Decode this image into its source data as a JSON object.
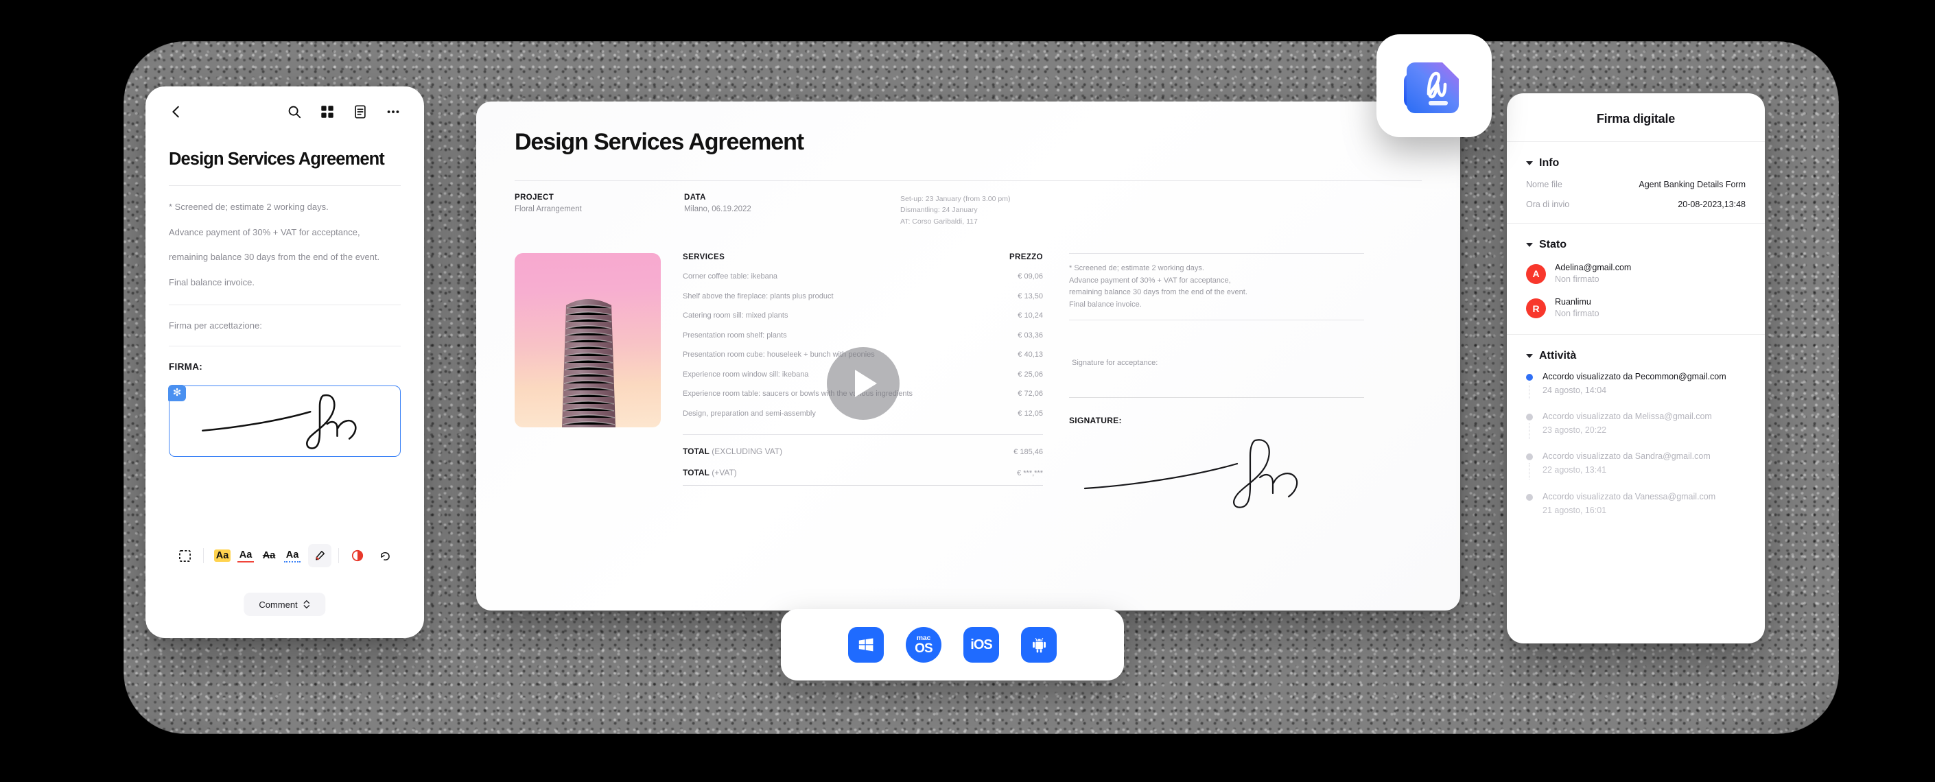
{
  "mobile_panel": {
    "back_icon": "chevron-left-icon",
    "tools": [
      "search-icon",
      "grid-icon",
      "document-icon",
      "more-icon"
    ],
    "title": "Design Services Agreement",
    "body_lines": [
      "* Screened de; estimate 2 working days.",
      "Advance payment of 30% + VAT for acceptance,",
      "remaining balance 30 days from the end of the event.",
      "Final balance invoice."
    ],
    "acceptance_label": "Firma per accettazione:",
    "signature_label": "FIRMA:",
    "signature_badge": "✻",
    "annotation_tools": [
      {
        "name": "select-area-tool",
        "label": ""
      },
      {
        "name": "highlight-tool",
        "label": "Aa"
      },
      {
        "name": "underline-tool",
        "label": "Aa"
      },
      {
        "name": "strikethrough-tool",
        "label": "Aa"
      },
      {
        "name": "squiggly-tool",
        "label": "Aa"
      },
      {
        "name": "marker-tool",
        "label": ""
      },
      {
        "name": "color-tool",
        "label": ""
      },
      {
        "name": "undo-tool",
        "label": "↺"
      }
    ],
    "comment_button": "Comment"
  },
  "document": {
    "title": "Design Services Agreement",
    "meta": [
      {
        "label": "PROJECT",
        "value": "Floral Arrangement"
      },
      {
        "label": "DATA",
        "value": "Milano, 06.19.2022"
      }
    ],
    "logistics": [
      "Set-up: 23 January (from 3.00 pm)",
      "Dismantling: 24 January",
      "AT: Corso Garibaldi, 117"
    ],
    "services_header": {
      "name": "SERVICES",
      "price": "PREZZO"
    },
    "services": [
      {
        "name": "Corner coffee table: ikebana",
        "price": "€ 09,06"
      },
      {
        "name": "Shelf above the fireplace: plants plus product",
        "price": "€ 13,50"
      },
      {
        "name": "Catering room sill: mixed plants",
        "price": "€ 10,24"
      },
      {
        "name": "Presentation room shelf: plants",
        "price": "€ 03,36"
      },
      {
        "name": "Presentation room cube: houseleek + bunch with peonies",
        "price": "€ 40,13"
      },
      {
        "name": "Experience room window sill: ikebana",
        "price": "€ 25,06"
      },
      {
        "name": "Experience room table: saucers or bowls with the various ingredients",
        "price": "€ 72,06"
      },
      {
        "name": "Design, preparation and semi-assembly",
        "price": "€ 12,05"
      }
    ],
    "totals": [
      {
        "bold": "TOTAL",
        "rest": " (EXCLUDING VAT)",
        "value": "€ 185,46"
      },
      {
        "bold": "TOTAL",
        "rest": " (+VAT)",
        "value": "€ ***,***"
      }
    ],
    "notes": [
      "* Screened de; estimate 2 working days.",
      "Advance payment of 30% + VAT for acceptance,",
      "remaining balance 30 days from the end of the event.",
      "Final balance invoice."
    ],
    "signature_for_acceptance": "Signature for acceptance:",
    "signature_label": "SIGNATURE:",
    "play_button": "play-icon",
    "photo_alt": "tower-building-photo"
  },
  "side_panel": {
    "title": "Firma digitale",
    "info": {
      "heading": "Info",
      "rows": [
        {
          "key": "Nome file",
          "value": "Agent Banking Details Form"
        },
        {
          "key": "Ora di invio",
          "value": "20-08-2023,13:48"
        }
      ]
    },
    "status": {
      "heading": "Stato",
      "people": [
        {
          "initial": "A",
          "name": "Adelina@gmail.com",
          "state": "Non firmato"
        },
        {
          "initial": "R",
          "name": "Ruanlimu",
          "state": "Non firmato"
        }
      ]
    },
    "activity": {
      "heading": "Attività",
      "items": [
        {
          "text": "Accordo visualizzato da Pecommon@gmail.com",
          "time": "24 agosto, 14:04",
          "active": true
        },
        {
          "text": "Accordo visualizzato da Melissa@gmail.com",
          "time": "23 agosto, 20:22",
          "active": false
        },
        {
          "text": "Accordo visualizzato da Sandra@gmail.com",
          "time": "22 agosto, 13:41",
          "active": false
        },
        {
          "text": "Accordo visualizzato da Vanessa@gmail.com",
          "time": "21 agosto, 16:01",
          "active": false
        }
      ]
    }
  },
  "app_badge": {
    "icon": "signature-document-app-icon"
  },
  "platform_bar": {
    "items": [
      {
        "name": "windows",
        "label": ""
      },
      {
        "name": "macos",
        "label_small": "mac",
        "label_big": "OS"
      },
      {
        "name": "ios",
        "label": "iOS"
      },
      {
        "name": "android",
        "label": ""
      }
    ]
  },
  "colors": {
    "accent_blue": "#1f6bff",
    "signature_border": "#3b82f6",
    "avatar_red": "#f8372c",
    "active_dot": "#2f6ff5",
    "highlight_yellow": "#ffd34e"
  }
}
